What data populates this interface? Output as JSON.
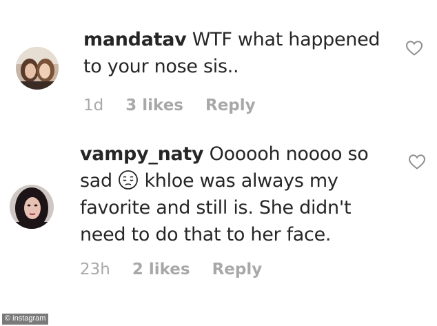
{
  "comments": [
    {
      "username": "mandatav",
      "text": "WTF what happened to your nose sis..",
      "time": "1d",
      "likes": "3 likes",
      "reply_label": "Reply",
      "avatar_icon": "profile-photo"
    },
    {
      "username": "vampy_naty",
      "text_before_emoji": "Oooooh noooo so sad",
      "emoji": "pensive-face-icon",
      "text_after_emoji": "khloe was always my favorite and still is. She didn't need to do that to her face.",
      "time": "23h",
      "likes": "2 likes",
      "reply_label": "Reply",
      "avatar_icon": "profile-photo"
    }
  ],
  "watermark": "© instagram",
  "colors": {
    "text": "#262626",
    "meta": "#a8a8a8",
    "heart_outline": "#8e8e8e"
  }
}
